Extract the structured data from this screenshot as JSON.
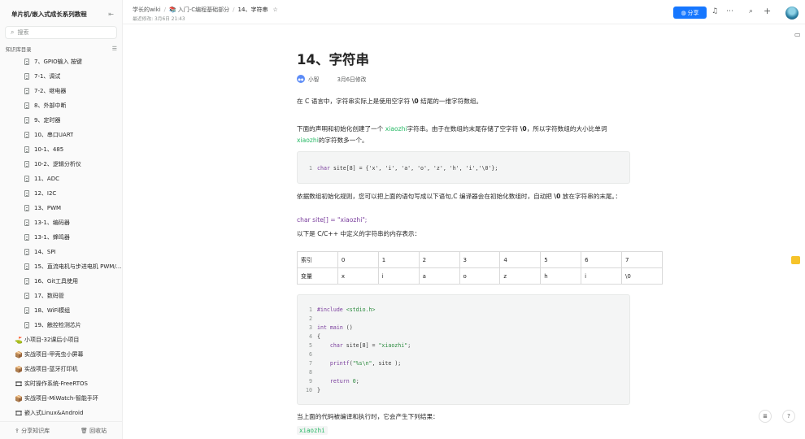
{
  "sidebar": {
    "title": "单片机/嵌入式成长系列教程",
    "search_placeholder": "搜索",
    "directory_label": "知识库目录",
    "items": [
      {
        "label": "7、GPIO输入 按键",
        "type": "child"
      },
      {
        "label": "7-1、调试",
        "type": "child"
      },
      {
        "label": "7-2、继电器",
        "type": "child"
      },
      {
        "label": "8、外部中断",
        "type": "child"
      },
      {
        "label": "9、定时器",
        "type": "child"
      },
      {
        "label": "10、串口UART",
        "type": "child"
      },
      {
        "label": "10-1、485",
        "type": "child"
      },
      {
        "label": "10-2、逻辑分析仪",
        "type": "child"
      },
      {
        "label": "11、ADC",
        "type": "child"
      },
      {
        "label": "12、I2C",
        "type": "child"
      },
      {
        "label": "13、PWM",
        "type": "child"
      },
      {
        "label": "13-1、编码器",
        "type": "child"
      },
      {
        "label": "13-1、蜂鸣器",
        "type": "child"
      },
      {
        "label": "14、SPI",
        "type": "child"
      },
      {
        "label": "15、直流电机与步进电机 PWM/...",
        "type": "child"
      },
      {
        "label": "16、Git工具使用",
        "type": "child"
      },
      {
        "label": "17、数码管",
        "type": "child"
      },
      {
        "label": "18、WiFi模组",
        "type": "child"
      },
      {
        "label": "19、触控检测芯片",
        "type": "child"
      },
      {
        "label": "小项目-32课后小项目",
        "type": "top",
        "icon": "⛳"
      },
      {
        "label": "实战项目-甲壳虫小屏幕",
        "type": "top",
        "icon": "📦"
      },
      {
        "label": "实战项目-蓝牙打印机",
        "type": "top",
        "icon": "📦"
      },
      {
        "label": "实时操作系统-FreeRTOS",
        "type": "top",
        "icon": "🎞"
      },
      {
        "label": "实战项目-MiWatch-智能手环",
        "type": "top",
        "icon": "📦"
      },
      {
        "label": "嵌入式Linux&Android",
        "type": "top",
        "icon": "🎞"
      }
    ],
    "footer": {
      "share": "分享知识库",
      "trash": "回收站"
    }
  },
  "header": {
    "crumb_wiki": "学长的wiki",
    "crumb_section": "入门-C编程基础部分",
    "crumb_current": "14、字符串",
    "modified": "最近修改: 3月6日 21:43",
    "share_label": "分享"
  },
  "article": {
    "title": "14、字符串",
    "author": "小智",
    "date": "3月6日修改",
    "p1_a": "在 C 语言中，字符串实际上是使用空字符 ",
    "p1_b": "\\0",
    "p1_c": " 结尾的一维字符数组。",
    "p2_a": "下面的声明和初始化创建了一个 ",
    "p2_b": "xiaozhi",
    "p2_c": "字符串。由于在数组的末尾存储了空字符 ",
    "p2_d": "\\0",
    "p2_e": "，所以字符数组的大小比单词",
    "p2_f": "xiaozhi",
    "p2_g": "的字符数多一个。",
    "code1_ln": "1",
    "code1_kw": "char",
    "code1_rest": " site[8] = {'x', 'i', 'a', 'o', 'z', 'h', 'i','\\0'};",
    "p3_a": "依据数组初始化规则，您可以把上面的语句写成以下语句,C 编译器会在初始化数组时，自动把 ",
    "p3_b": "\\0",
    "p3_c": " 放在字符串的末尾。：",
    "p4_kw": "char",
    "p4_rest": " site[] = \"xiaozhi\";",
    "p5": "以下是 C/C++ 中定义的字符串的内存表示：",
    "table": [
      [
        "索引",
        "0",
        "1",
        "2",
        "3",
        "4",
        "5",
        "6",
        "7"
      ],
      [
        "变量",
        "x",
        "i",
        "a",
        "o",
        "z",
        "h",
        "i",
        "\\0"
      ]
    ],
    "code2": [
      {
        "n": "1",
        "parts": [
          [
            "pp",
            "#include "
          ],
          [
            "hdr",
            "<stdio.h>"
          ]
        ]
      },
      {
        "n": "2",
        "parts": []
      },
      {
        "n": "3",
        "parts": [
          [
            "kw",
            "int"
          ],
          [
            "plain",
            " "
          ],
          [
            "kw",
            "main"
          ],
          [
            "plain",
            " ()"
          ]
        ]
      },
      {
        "n": "4",
        "parts": [
          [
            "plain",
            "{"
          ]
        ]
      },
      {
        "n": "5",
        "parts": [
          [
            "plain",
            "    "
          ],
          [
            "kw",
            "char"
          ],
          [
            "plain",
            " site[8] = "
          ],
          [
            "str",
            "\"xiaozhi\""
          ],
          [
            "plain",
            ";"
          ]
        ]
      },
      {
        "n": "6",
        "parts": []
      },
      {
        "n": "7",
        "parts": [
          [
            "plain",
            "    "
          ],
          [
            "kw",
            "printf"
          ],
          [
            "plain",
            "("
          ],
          [
            "str",
            "\"%s\\n\""
          ],
          [
            "plain",
            ", site );"
          ]
        ]
      },
      {
        "n": "8",
        "parts": []
      },
      {
        "n": "9",
        "parts": [
          [
            "plain",
            "    "
          ],
          [
            "kw",
            "return"
          ],
          [
            "plain",
            " "
          ],
          [
            "str",
            "0"
          ],
          [
            "plain",
            ";"
          ]
        ]
      },
      {
        "n": "10",
        "parts": [
          [
            "plain",
            "}"
          ]
        ]
      }
    ],
    "p6": "当上面的代码被编译和执行时，它会产生下列结果：",
    "output": "xiaozhi"
  },
  "colors": {
    "accent": "#1677ff",
    "green": "#25b864",
    "keyword": "#7a3e9d"
  }
}
